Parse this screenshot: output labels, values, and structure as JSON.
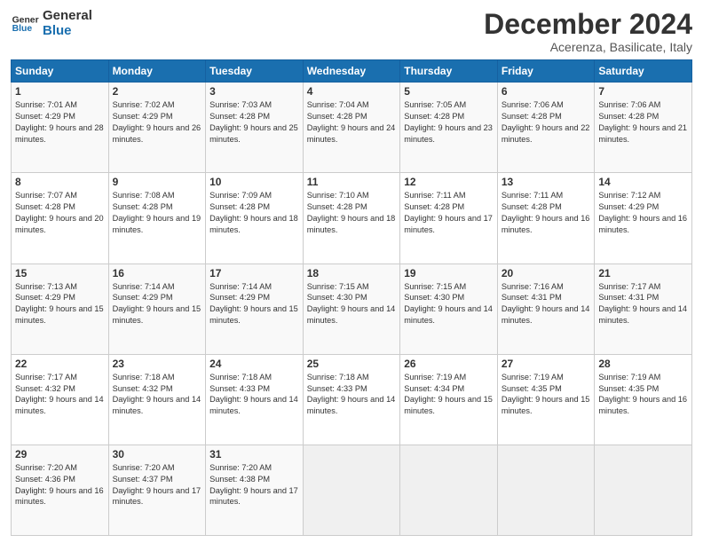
{
  "logo": {
    "text_general": "General",
    "text_blue": "Blue"
  },
  "header": {
    "title": "December 2024",
    "subtitle": "Acerenza, Basilicate, Italy"
  },
  "days_of_week": [
    "Sunday",
    "Monday",
    "Tuesday",
    "Wednesday",
    "Thursday",
    "Friday",
    "Saturday"
  ],
  "weeks": [
    [
      {
        "day": "1",
        "sunrise": "7:01 AM",
        "sunset": "4:29 PM",
        "daylight": "9 hours and 28 minutes."
      },
      {
        "day": "2",
        "sunrise": "7:02 AM",
        "sunset": "4:29 PM",
        "daylight": "9 hours and 26 minutes."
      },
      {
        "day": "3",
        "sunrise": "7:03 AM",
        "sunset": "4:28 PM",
        "daylight": "9 hours and 25 minutes."
      },
      {
        "day": "4",
        "sunrise": "7:04 AM",
        "sunset": "4:28 PM",
        "daylight": "9 hours and 24 minutes."
      },
      {
        "day": "5",
        "sunrise": "7:05 AM",
        "sunset": "4:28 PM",
        "daylight": "9 hours and 23 minutes."
      },
      {
        "day": "6",
        "sunrise": "7:06 AM",
        "sunset": "4:28 PM",
        "daylight": "9 hours and 22 minutes."
      },
      {
        "day": "7",
        "sunrise": "7:06 AM",
        "sunset": "4:28 PM",
        "daylight": "9 hours and 21 minutes."
      }
    ],
    [
      {
        "day": "8",
        "sunrise": "7:07 AM",
        "sunset": "4:28 PM",
        "daylight": "9 hours and 20 minutes."
      },
      {
        "day": "9",
        "sunrise": "7:08 AM",
        "sunset": "4:28 PM",
        "daylight": "9 hours and 19 minutes."
      },
      {
        "day": "10",
        "sunrise": "7:09 AM",
        "sunset": "4:28 PM",
        "daylight": "9 hours and 18 minutes."
      },
      {
        "day": "11",
        "sunrise": "7:10 AM",
        "sunset": "4:28 PM",
        "daylight": "9 hours and 18 minutes."
      },
      {
        "day": "12",
        "sunrise": "7:11 AM",
        "sunset": "4:28 PM",
        "daylight": "9 hours and 17 minutes."
      },
      {
        "day": "13",
        "sunrise": "7:11 AM",
        "sunset": "4:28 PM",
        "daylight": "9 hours and 16 minutes."
      },
      {
        "day": "14",
        "sunrise": "7:12 AM",
        "sunset": "4:29 PM",
        "daylight": "9 hours and 16 minutes."
      }
    ],
    [
      {
        "day": "15",
        "sunrise": "7:13 AM",
        "sunset": "4:29 PM",
        "daylight": "9 hours and 15 minutes."
      },
      {
        "day": "16",
        "sunrise": "7:14 AM",
        "sunset": "4:29 PM",
        "daylight": "9 hours and 15 minutes."
      },
      {
        "day": "17",
        "sunrise": "7:14 AM",
        "sunset": "4:29 PM",
        "daylight": "9 hours and 15 minutes."
      },
      {
        "day": "18",
        "sunrise": "7:15 AM",
        "sunset": "4:30 PM",
        "daylight": "9 hours and 14 minutes."
      },
      {
        "day": "19",
        "sunrise": "7:15 AM",
        "sunset": "4:30 PM",
        "daylight": "9 hours and 14 minutes."
      },
      {
        "day": "20",
        "sunrise": "7:16 AM",
        "sunset": "4:31 PM",
        "daylight": "9 hours and 14 minutes."
      },
      {
        "day": "21",
        "sunrise": "7:17 AM",
        "sunset": "4:31 PM",
        "daylight": "9 hours and 14 minutes."
      }
    ],
    [
      {
        "day": "22",
        "sunrise": "7:17 AM",
        "sunset": "4:32 PM",
        "daylight": "9 hours and 14 minutes."
      },
      {
        "day": "23",
        "sunrise": "7:18 AM",
        "sunset": "4:32 PM",
        "daylight": "9 hours and 14 minutes."
      },
      {
        "day": "24",
        "sunrise": "7:18 AM",
        "sunset": "4:33 PM",
        "daylight": "9 hours and 14 minutes."
      },
      {
        "day": "25",
        "sunrise": "7:18 AM",
        "sunset": "4:33 PM",
        "daylight": "9 hours and 14 minutes."
      },
      {
        "day": "26",
        "sunrise": "7:19 AM",
        "sunset": "4:34 PM",
        "daylight": "9 hours and 15 minutes."
      },
      {
        "day": "27",
        "sunrise": "7:19 AM",
        "sunset": "4:35 PM",
        "daylight": "9 hours and 15 minutes."
      },
      {
        "day": "28",
        "sunrise": "7:19 AM",
        "sunset": "4:35 PM",
        "daylight": "9 hours and 16 minutes."
      }
    ],
    [
      {
        "day": "29",
        "sunrise": "7:20 AM",
        "sunset": "4:36 PM",
        "daylight": "9 hours and 16 minutes."
      },
      {
        "day": "30",
        "sunrise": "7:20 AM",
        "sunset": "4:37 PM",
        "daylight": "9 hours and 17 minutes."
      },
      {
        "day": "31",
        "sunrise": "7:20 AM",
        "sunset": "4:38 PM",
        "daylight": "9 hours and 17 minutes."
      },
      null,
      null,
      null,
      null
    ]
  ]
}
